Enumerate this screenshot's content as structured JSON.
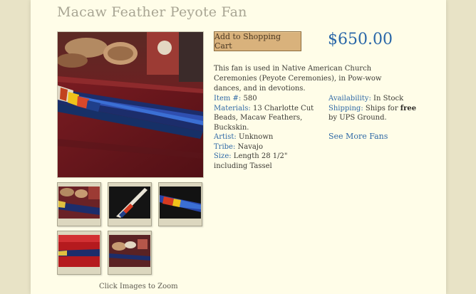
{
  "product": {
    "title": "Macaw Feather Peyote Fan",
    "price": "$650.00",
    "add_to_cart_label": "Add to Shopping Cart",
    "description": "This fan is used in Native American Church Ceremonies (Peyote Ceremonies), in Pow-wow dances, and in devotions."
  },
  "specs": {
    "item_label": "Item #:",
    "item_value": "580",
    "materials_label": "Materials:",
    "materials_value": "13 Charlotte Cut Beads, Macaw Feathers, Buckskin.",
    "artist_label": "Artist:",
    "artist_value": "Unknown",
    "tribe_label": "Tribe:",
    "tribe_value": "Navajo",
    "size_label": "Size:",
    "size_value": "Length 28 1/2\" including Tassel"
  },
  "availability": {
    "availability_label": "Availability:",
    "availability_value": "In Stock",
    "shipping_label": "Shipping:",
    "shipping_pre": "Ships for",
    "shipping_free": "free",
    "shipping_post": "by UPS Ground."
  },
  "links": {
    "see_more": "See More Fans"
  },
  "gallery": {
    "zoom_note": "Click Images to Zoom",
    "thumbnails": [
      "thumb-1",
      "thumb-2",
      "thumb-3",
      "thumb-4",
      "thumb-5"
    ]
  },
  "colors": {
    "accent": "#2f69a6",
    "background": "#e8e3c6",
    "panel": "#fffde8",
    "button": "#d9b27c"
  }
}
